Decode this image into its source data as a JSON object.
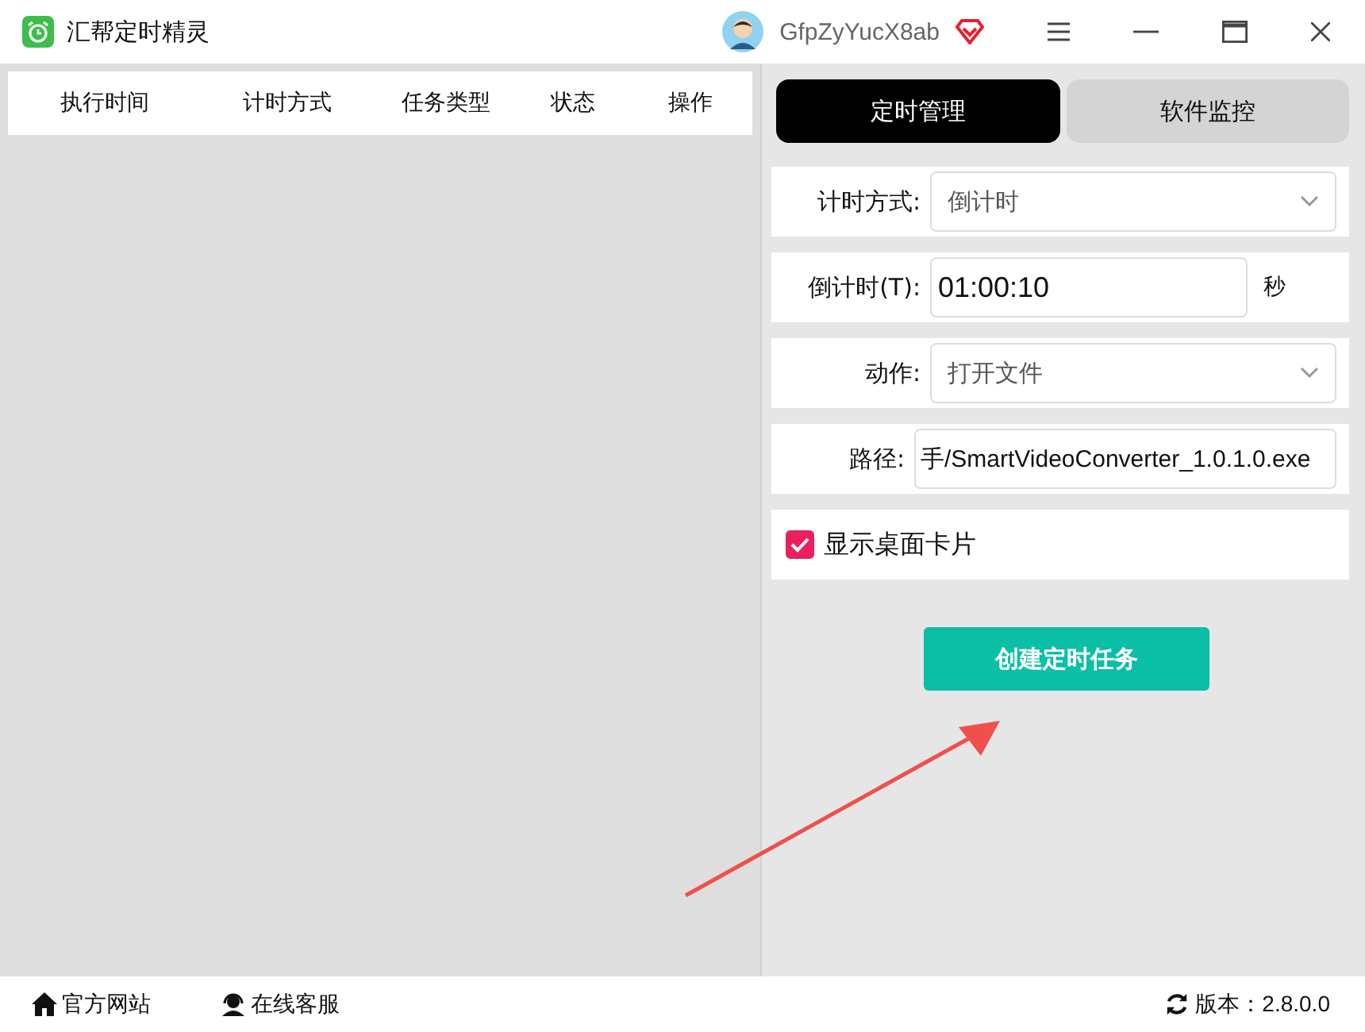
{
  "window": {
    "title": "汇帮定时精灵",
    "username": "GfpZyYucX8ab"
  },
  "table": {
    "columns": [
      "执行时间",
      "计时方式",
      "任务类型",
      "状态",
      "操作"
    ]
  },
  "tabs": [
    {
      "label": "定时管理",
      "selected": true
    },
    {
      "label": "软件监控",
      "selected": false
    }
  ],
  "form": [
    {
      "kind": "select",
      "label": "计时方式:",
      "value": "倒计时"
    },
    {
      "kind": "input",
      "label": "倒计时(T):",
      "value": "01:00:10",
      "unit": "秒"
    },
    {
      "kind": "select",
      "label": "动作:",
      "value": "打开文件"
    },
    {
      "kind": "path",
      "label": "路径:",
      "value": "手/SmartVideoConverter_1.0.1.0.exe"
    },
    {
      "kind": "checkbox",
      "label": "显示桌面卡片",
      "checked": true
    }
  ],
  "create_button": "创建定时任务",
  "status_bar": {
    "links": [
      {
        "kind": "home",
        "label": "官方网站"
      },
      {
        "kind": "support",
        "label": "在线客服"
      }
    ],
    "version": "版本：2.8.0.0"
  }
}
